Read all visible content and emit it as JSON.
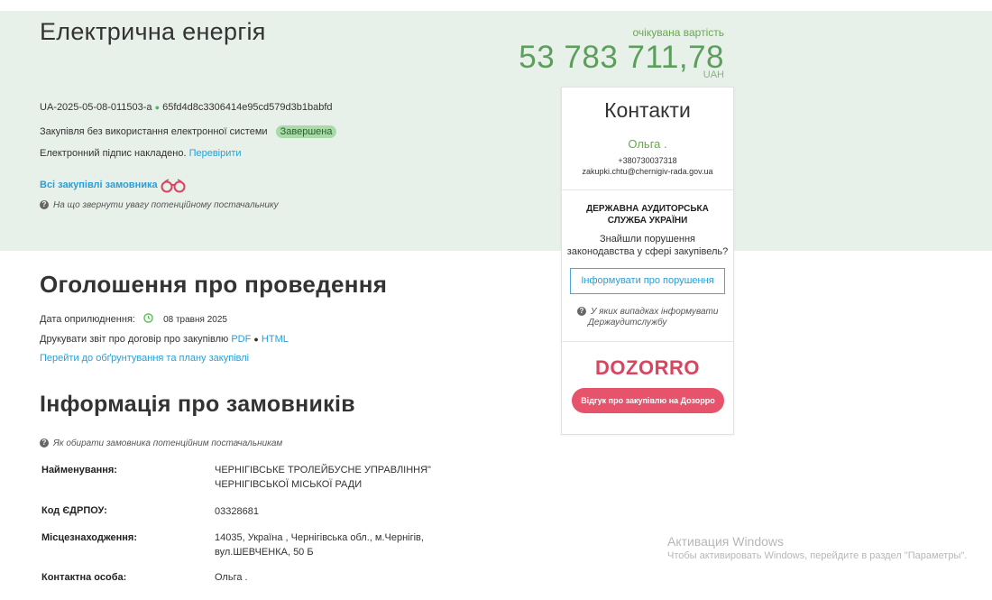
{
  "header": {
    "title": "Електрична енергія",
    "expected_label": "очікувана вартість",
    "expected_value": "53 783 711,78",
    "currency": "UAH",
    "tender_id": "UA-2025-05-08-011503-a",
    "hash": "65fd4d8c3306414e95cd579d3b1babfd",
    "procurement_type": "Закупівля без використання електронної системи",
    "status": "Завершена",
    "signature_text": "Електронний підпис накладено.",
    "signature_check": "Перевірити",
    "all_purchases": "Всі закупівлі замовника",
    "attention_note": "На що звернути увагу потенційному постачальнику"
  },
  "announcement": {
    "heading": "Оголошення про проведення",
    "pub_label": "Дата оприлюднення:",
    "pub_date": "08 травня 2025",
    "print_label": "Друкувати звіт про договір про закупівлю",
    "pdf": "PDF",
    "html": "HTML",
    "plan_link": "Перейти до обґрунтування та плану закупівлі"
  },
  "customer": {
    "heading": "Інформація про замовників",
    "hint": "Як обирати замовника потенційним постачальникам",
    "name_label": "Найменування:",
    "name_line1": "ЧЕРНІГІВСЬКЕ ТРОЛЕЙБУСНЕ УПРАВЛІННЯ\"",
    "name_line2": "ЧЕРНІГІВСЬКОЇ МІСЬКОЇ РАДИ",
    "edrpou_label": "Код ЄДРПОУ:",
    "edrpou": "03328681",
    "location_label": "Місцезнаходження:",
    "location_line1": "14035, Україна , Чернігівська обл., м.Чернігів,",
    "location_line2": "вул.ШЕВЧЕНКА, 50 Б",
    "contact_label": "Контактна особа:",
    "contact": "Ольга ."
  },
  "panel": {
    "title": "Контакти",
    "name": "Ольга .",
    "phone": "+380730037318",
    "email": "zakupki.chtu@chernigiv-rada.gov.ua",
    "org_line1": "ДЕРЖАВНА АУДИТОРСЬКА",
    "org_line2": "СЛУЖБА УКРАЇНИ",
    "question_line1": "Знайшли порушення",
    "question_line2": "законодавства у сфері закупівель?",
    "report_button": "Інформувати про порушення",
    "when_line1": "У яких випадках інформувати",
    "when_line2": "Держаудитслужбу",
    "logo": "DOZORRO",
    "feedback_button": "Відгук про закупівлю на Дозорро"
  },
  "windows": {
    "activation_title": "Активация Windows",
    "activation_text": "Чтобы активировать Windows, перейдите в раздел \"Параметры\"."
  },
  "colors": {
    "band": "#e8f0ea",
    "green": "#5c9e5c",
    "link": "#2a9fd6",
    "dozorro": "#e8536c"
  }
}
